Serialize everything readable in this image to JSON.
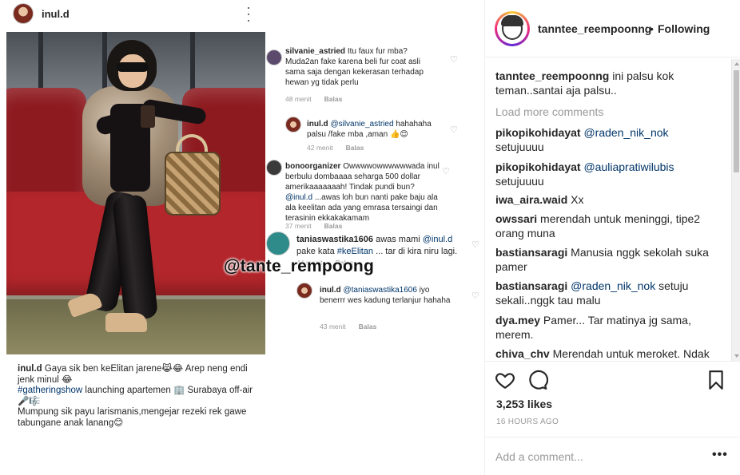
{
  "post_image": {
    "inner_username": "inul.d",
    "watermark": "@tante_rempoong",
    "embedded_comments": [
      {
        "user": "silvanie_astried",
        "text": " Itu faux fur mba? Muda2an fake karena beli fur coat asli sama saja dengan kekerasan terhadap hewan yg tidak perlu",
        "time": "48 menit",
        "reply": "Balas"
      },
      {
        "user": "inul.d",
        "mention": " @silvanie_astried",
        "text": " hahahaha palsu /fake mba ,aman 👍😊",
        "time": "42 menit",
        "reply": "Balas"
      },
      {
        "user": "bonoorganizer",
        "text": " Owwwwowwwwwwada inul berbulu dombaaaa seharga 500 dollar amerikaaaaaaah!  Tindak pundi bun?",
        "mention": "@inul.d",
        "text2": " ...awas loh bun nanti pake baju ala ala keelitan ada yang emrasa tersaingi dan terasinin ekkakakamam",
        "time": "37 menit",
        "reply": "Balas"
      },
      {
        "user": "taniaswastika1606",
        "text": " awas mami ",
        "mention": "@inul.d",
        "text2": " pake kata ",
        "tag": "#keElitan",
        "text3": " ... tar di kira niru lagi.",
        "time": "44 menit",
        "reply": "Balas"
      },
      {
        "user": "inul.d",
        "mention": " @taniaswastika1606",
        "text": " iyo benerrr wes kadung terlanjur hahaha",
        "time": "43 menit",
        "reply": "Balas"
      }
    ],
    "caption": {
      "user": "inul.d",
      "line1": " Gaya sik ben keElitan jarene😹😂  Arep neng endi jenk minul 😂",
      "tag": "#gatheringshow",
      "line2": " launching apartemen 🏢 Surabaya off-air🎤🎼",
      "line3": "Mumpung sik payu larismanis,mengejar rezeki rek gawe tabungane anak lanang😊"
    }
  },
  "sidebar": {
    "username": "tanntee_reempoonng",
    "separator": "•",
    "follow_status": "Following",
    "caption": {
      "user": "tanntee_reempoonng",
      "text": " ini palsu kok teman..santai aja palsu.."
    },
    "load_more": "Load more comments",
    "comments": [
      {
        "user": "pikopikohidayat",
        "mention": " @raden_nik_nok",
        "text": " setujuuuu"
      },
      {
        "user": "pikopikohidayat",
        "mention": " @auliapratiwilubis",
        "text": " setujuuuu"
      },
      {
        "user": "iwa_aira.waid",
        "mention": "",
        "text": " Xx"
      },
      {
        "user": "owssari",
        "mention": "",
        "text": " merendah untuk meninggi, tipe2 orang muna"
      },
      {
        "user": "bastiansaragi",
        "mention": "",
        "text": " Manusia nggk sekolah suka pamer"
      },
      {
        "user": "bastiansaragi",
        "mention": " @raden_nik_nok",
        "text": " setuju sekali..nggk tau malu"
      },
      {
        "user": "dya.mey",
        "mention": "",
        "text": " Pamer... Tar matinya jg sama, merem."
      },
      {
        "user": "chiva_chv",
        "mention": "",
        "text": " Merendah untuk meroket. Ndak"
      }
    ],
    "likes": "3,253 likes",
    "time_ago": "16 HOURS AGO",
    "add_comment_placeholder": "Add a comment...",
    "more_label": "•••"
  },
  "icons": {
    "like": "heart-icon",
    "comment": "comment-bubble-icon",
    "save": "bookmark-icon",
    "more": "more-dots-icon"
  }
}
